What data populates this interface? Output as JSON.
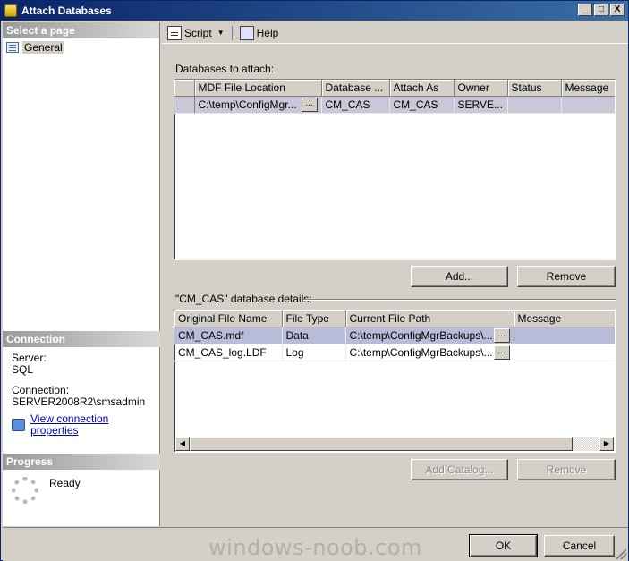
{
  "window": {
    "title": "Attach Databases",
    "min": "_",
    "max": "□",
    "close": "X"
  },
  "left": {
    "select_page_header": "Select a page",
    "pages": [
      {
        "label": "General"
      }
    ],
    "connection_header": "Connection",
    "server_label": "Server:",
    "server_value": "SQL",
    "connection_label": "Connection:",
    "connection_value": "SERVER2008R2\\smsadmin",
    "view_link": "View connection properties",
    "progress_header": "Progress",
    "progress_status": "Ready"
  },
  "toolbar": {
    "script_label": "Script",
    "help_label": "Help"
  },
  "attach": {
    "section_label": "Databases to attach:",
    "columns": [
      "MDF File Location",
      "Database ...",
      "Attach As",
      "Owner",
      "Status",
      "Message"
    ],
    "rows": [
      {
        "mdf": "C:\\temp\\ConfigMgr...",
        "database": "CM_CAS",
        "attach_as": "CM_CAS",
        "owner": "SERVE...",
        "status": "",
        "message": ""
      }
    ],
    "ellipsis": "...",
    "add_button": "Add...",
    "remove_button": "Remove"
  },
  "details": {
    "section_label": "\"CM_CAS\" database details:",
    "columns": [
      "Original File Name",
      "File Type",
      "Current File Path",
      "Message"
    ],
    "rows": [
      {
        "name": "CM_CAS.mdf",
        "type": "Data",
        "path": "C:\\temp\\ConfigMgrBackups\\...",
        "message": ""
      },
      {
        "name": "CM_CAS_log.LDF",
        "type": "Log",
        "path": "C:\\temp\\ConfigMgrBackups\\...",
        "message": ""
      }
    ],
    "ellipsis": "...",
    "add_catalog_button": "Add Catalog...",
    "remove_button": "Remove"
  },
  "footer": {
    "ok_button": "OK",
    "cancel_button": "Cancel",
    "watermark": "windows-noob.com"
  }
}
